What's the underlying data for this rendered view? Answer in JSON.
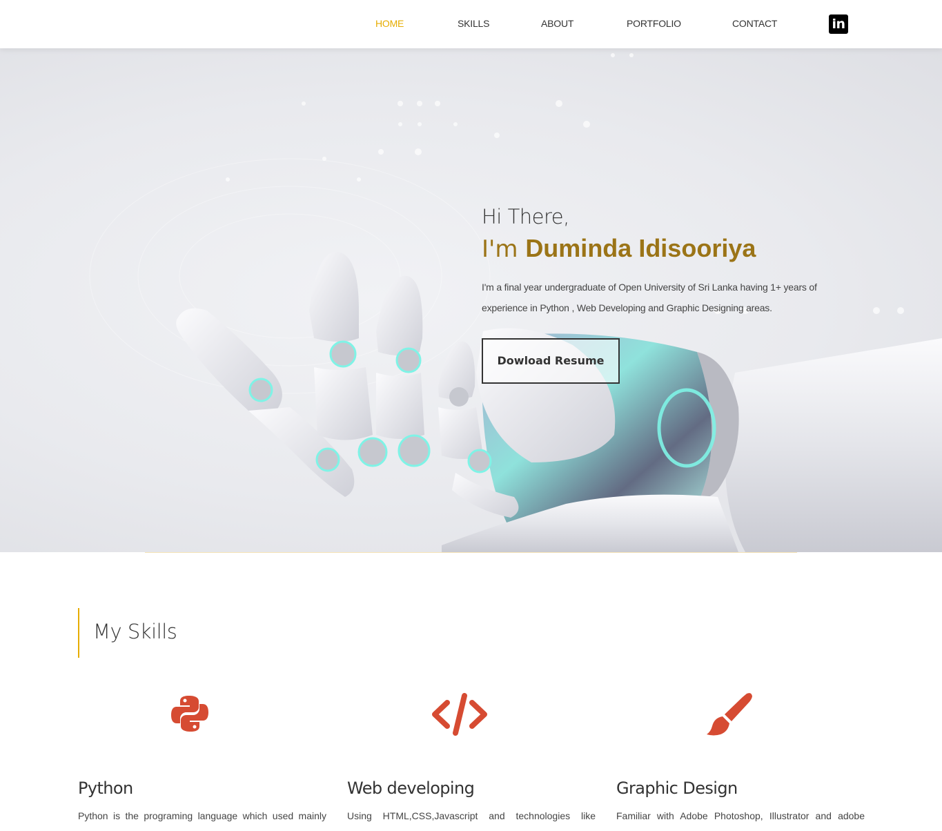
{
  "nav": {
    "items": [
      {
        "label": "HOME",
        "active": true
      },
      {
        "label": "SKILLS",
        "active": false
      },
      {
        "label": "ABOUT",
        "active": false
      },
      {
        "label": "PORTFOLIO",
        "active": false
      },
      {
        "label": "CONTACT",
        "active": false
      }
    ],
    "linkedin_icon": "linkedin-icon",
    "linkedin_text": "in",
    "active_color": "#e6ac00"
  },
  "hero": {
    "greeting": "Hi There,",
    "intro_prefix": "I'm",
    "name": "Duminda Idisooriya",
    "description": "I'm a final year undergraduate of Open University of Sri Lanka having 1+ years of experience in Python , Web Developing and Graphic Designing areas.",
    "button_label": "Dowload Resume",
    "name_color": "#9b7417"
  },
  "skills": {
    "title": "My Skills",
    "accent_color": "#e6ac00",
    "icon_color": "#d64b32",
    "items": [
      {
        "icon": "python-icon",
        "name": "Python",
        "text": "Python is the programing language which used mainly"
      },
      {
        "icon": "code-icon",
        "name": "Web developing",
        "text": "Using HTML,CSS,Javascript and technologies like"
      },
      {
        "icon": "paintbrush-icon",
        "name": "Graphic Design",
        "text": "Familiar with Adobe Photoshop, Illustrator and adobe"
      }
    ]
  }
}
